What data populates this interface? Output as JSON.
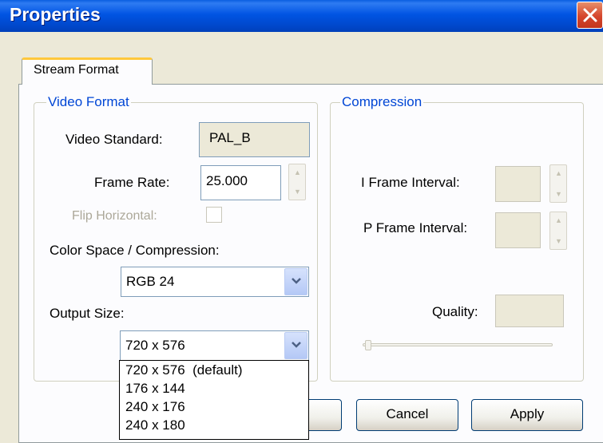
{
  "window": {
    "title": "Properties"
  },
  "tabs": [
    {
      "label": "Stream Format"
    }
  ],
  "video_format": {
    "legend": "Video Format",
    "video_standard_label": "Video Standard:",
    "video_standard_value": "PAL_B",
    "frame_rate_label": "Frame Rate:",
    "frame_rate_value": "25.000",
    "flip_horizontal_label": "Flip Horizontal:",
    "color_space_label": "Color Space / Compression:",
    "color_space_value": "RGB 24",
    "output_size_label": "Output Size:",
    "output_size_value": "720 x 576",
    "output_size_options": [
      "720 x 576  (default)",
      "176 x 144",
      "240 x 176",
      "240 x 180"
    ]
  },
  "compression": {
    "legend": "Compression",
    "i_frame_label": "I Frame Interval:",
    "p_frame_label": "P Frame Interval:",
    "quality_label": "Quality:",
    "quality_slider_position": 0
  },
  "buttons": {
    "cancel": "Cancel",
    "apply": "Apply"
  },
  "colors": {
    "title_bar": "#0054E3",
    "legend_text": "#0046D5",
    "tab_highlight": "#FFC83C",
    "close_button": "#D5452C"
  }
}
